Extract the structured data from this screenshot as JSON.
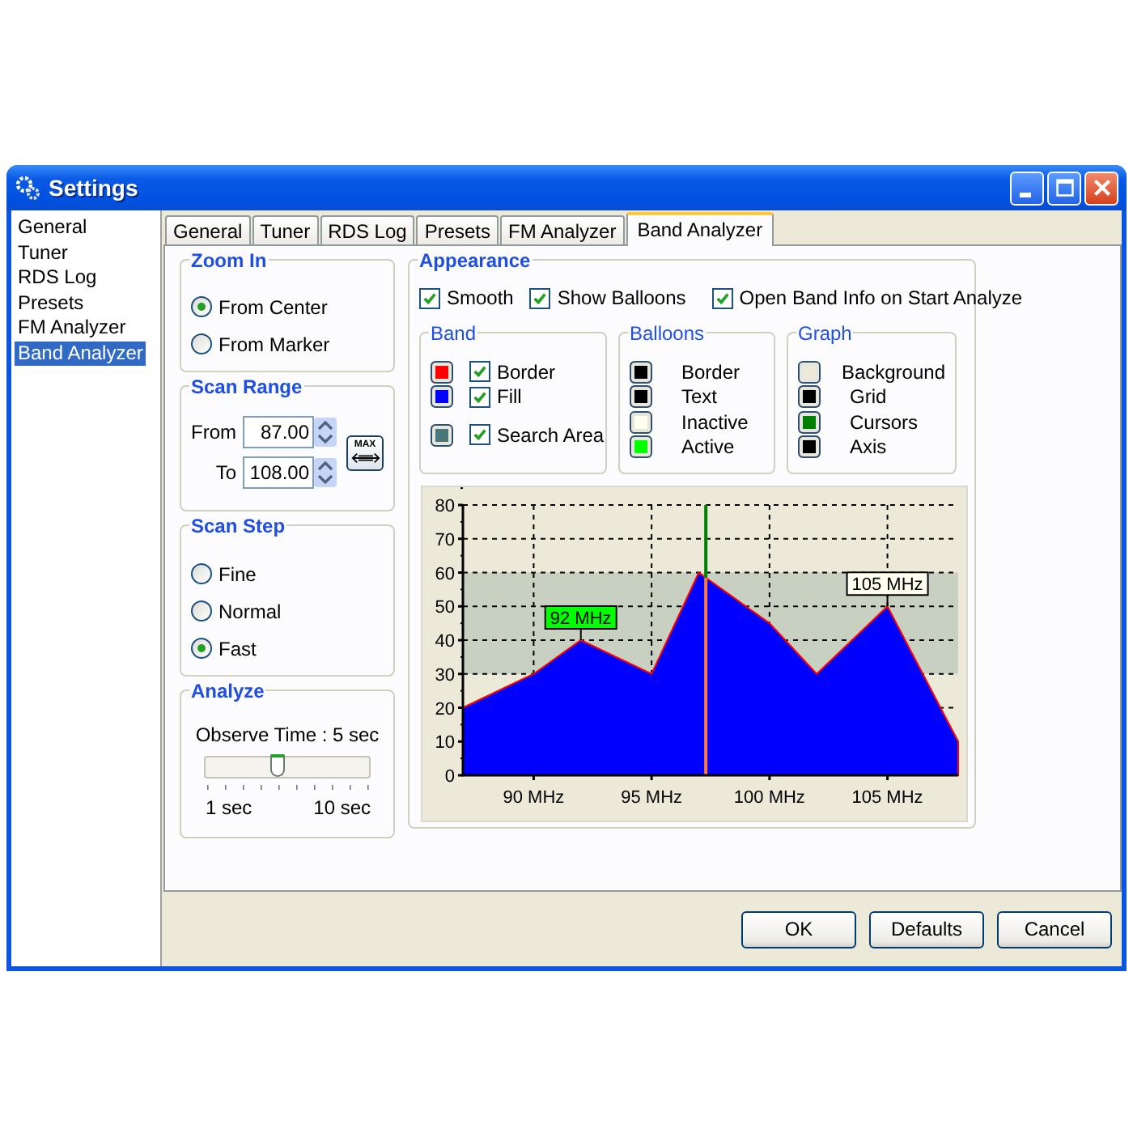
{
  "window": {
    "title": "Settings"
  },
  "sidebar": {
    "items": [
      {
        "label": "General",
        "selected": false
      },
      {
        "label": "Tuner",
        "selected": false
      },
      {
        "label": "RDS Log",
        "selected": false
      },
      {
        "label": "Presets",
        "selected": false
      },
      {
        "label": "FM Analyzer",
        "selected": false
      },
      {
        "label": "Band Analyzer",
        "selected": true
      }
    ]
  },
  "tabs": [
    {
      "label": "General",
      "selected": false
    },
    {
      "label": "Tuner",
      "selected": false
    },
    {
      "label": "RDS Log",
      "selected": false
    },
    {
      "label": "Presets",
      "selected": false
    },
    {
      "label": "FM Analyzer",
      "selected": false
    },
    {
      "label": "Band Analyzer",
      "selected": true
    }
  ],
  "zoom_in": {
    "title": "Zoom In",
    "options": [
      {
        "label": "From Center",
        "selected": true
      },
      {
        "label": "From Marker",
        "selected": false
      }
    ]
  },
  "scan_range": {
    "title": "Scan Range",
    "fields": [
      {
        "label": "From",
        "value": "87.00"
      },
      {
        "label": "To",
        "value": "108.00"
      }
    ],
    "max_button": "MAX"
  },
  "scan_step": {
    "title": "Scan Step",
    "options": [
      {
        "label": "Fine",
        "selected": false
      },
      {
        "label": "Normal",
        "selected": false
      },
      {
        "label": "Fast",
        "selected": true
      }
    ]
  },
  "analyze": {
    "title": "Analyze",
    "caption": "Observe Time : 5 sec",
    "slider": {
      "level": 0.444
    },
    "min_label": "1 sec",
    "max_label": "10 sec"
  },
  "appearance": {
    "title": "Appearance",
    "options": [
      {
        "label": "Smooth",
        "checked": true
      },
      {
        "label": "Show Balloons",
        "checked": true
      },
      {
        "label": "Open Band Info on Start Analyze",
        "checked": true
      }
    ],
    "band": {
      "title": "Band",
      "items": [
        {
          "label": "Border",
          "color": "#ff0000",
          "checked": true
        },
        {
          "label": "Fill",
          "color": "#0000ff",
          "checked": true
        },
        {
          "label": "Search Area",
          "color": "#4a7878",
          "checked": true
        }
      ]
    },
    "balloons": {
      "title": "Balloons",
      "items": [
        {
          "label": "Border",
          "color": "#000000"
        },
        {
          "label": "Text",
          "color": "#000000"
        },
        {
          "label": "Inactive",
          "color": "#fffff0"
        },
        {
          "label": "Active",
          "color": "#00ff00"
        }
      ]
    },
    "graph": {
      "title": "Graph",
      "items": [
        {
          "label": "Background",
          "color": "#ece9d8"
        },
        {
          "label": "Grid",
          "color": "#000000"
        },
        {
          "label": "Cursors",
          "color": "#008000"
        },
        {
          "label": "Axis",
          "color": "#000000"
        }
      ]
    },
    "chart_data": {
      "type": "area",
      "x": [
        87,
        90,
        92,
        95,
        97,
        100,
        102,
        105,
        108
      ],
      "series": [
        {
          "color": "#0000ff",
          "values": [
            20,
            30,
            40,
            30,
            60,
            45,
            30,
            50,
            10
          ]
        }
      ],
      "grid": true,
      "xlim": [
        87,
        108
      ],
      "ylim": [
        0,
        80
      ],
      "xticks": [
        {
          "value": 90,
          "label": "90 MHz"
        },
        {
          "value": 95,
          "label": "95 MHz"
        },
        {
          "value": 100,
          "label": "100 MHz"
        },
        {
          "value": 105,
          "label": "105 MHz"
        }
      ],
      "yticks": [
        0,
        10,
        20,
        30,
        40,
        50,
        60,
        70,
        80
      ],
      "bands": [
        {
          "axis": "y",
          "from": 30,
          "to": 60
        }
      ],
      "ref_lines": [
        {
          "axis": "x",
          "value": 97.3
        }
      ],
      "annotations": [
        {
          "x": 92,
          "y": 40,
          "text": "92 MHz"
        },
        {
          "x": 105,
          "y": 50,
          "text": "105 MHz"
        }
      ]
    },
    "balloon_states": [
      {
        "active": true
      },
      {
        "active": false
      }
    ]
  },
  "buttons": [
    {
      "label": "OK"
    },
    {
      "label": "Defaults"
    },
    {
      "label": "Cancel"
    }
  ]
}
